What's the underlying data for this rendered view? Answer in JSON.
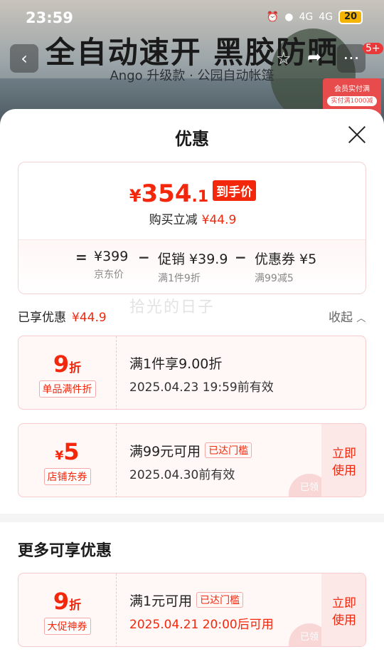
{
  "status": {
    "time": "23:59",
    "battery": "20",
    "net1": "4G",
    "net2": "4G"
  },
  "banner": {
    "title": "全自动速开 黑胶防晒",
    "subtitle": "Ango 升级款 · 公园自动帐篷",
    "side_card_top": "会员实付满",
    "side_card_pill": "实付满1000减",
    "badge": "5+"
  },
  "sheet": {
    "title": "优惠",
    "summary": {
      "currency": "¥",
      "price_int": "354",
      "price_dec": ".1",
      "price_tag": "到手价",
      "discount_label": "购买立减",
      "discount_value": "¥44.9",
      "eq": "=",
      "minus": "−",
      "items": [
        {
          "value": "¥399",
          "label": "京东价"
        },
        {
          "value": "促销 ¥39.9",
          "label": "满1件9折"
        },
        {
          "value": "优惠券 ¥5",
          "label": "满99减5"
        }
      ]
    },
    "watermark": "拾光的日子",
    "enjoyed_label": "已享优惠",
    "enjoyed_value": "¥44.9",
    "collapse_label": "收起",
    "coupons": [
      {
        "amount": "9",
        "unit": "折",
        "tag": "单品满件折",
        "title": "满1件享9.00折",
        "threshold": "",
        "date": "2025.04.23 19:59前有效",
        "action": "",
        "stamp": ""
      },
      {
        "prefix": "¥",
        "amount": "5",
        "tag": "店铺东券",
        "title": "满99元可用",
        "threshold": "已达门槛",
        "date": "2025.04.30前有效",
        "action_line1": "立即",
        "action_line2": "使用",
        "stamp": "已领"
      }
    ],
    "more_title": "更多可享优惠",
    "more_coupons": [
      {
        "amount": "9",
        "unit": "折",
        "tag": "大促神券",
        "title": "满1元可用",
        "threshold": "已达门槛",
        "date": "2025.04.21 20:00后可用",
        "action_line1": "立即",
        "action_line2": "使用",
        "stamp": "已领"
      }
    ]
  }
}
